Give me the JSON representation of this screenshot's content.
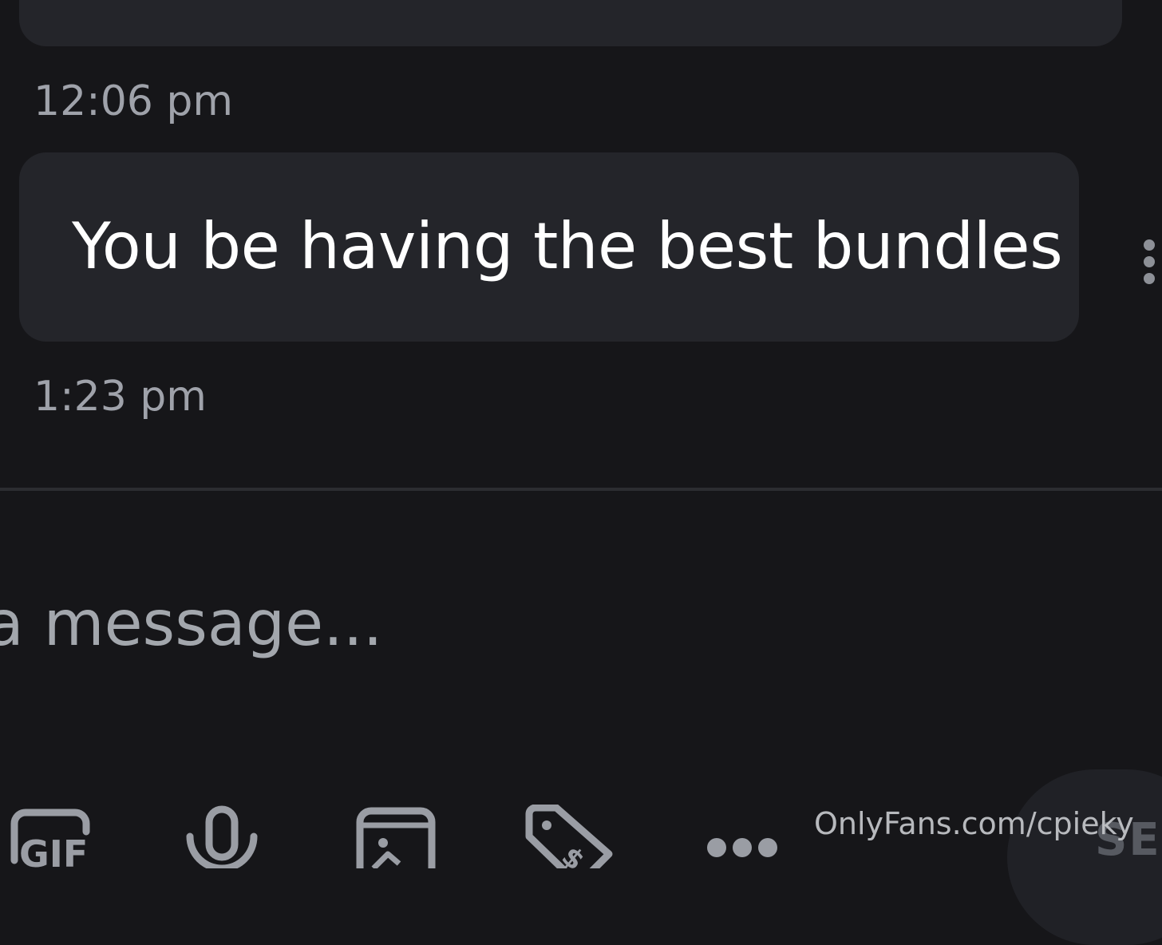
{
  "messages": [
    {
      "text": "",
      "time": "12:06 pm"
    },
    {
      "text": "You be having the best bundles",
      "time": "1:23 pm"
    }
  ],
  "composer": {
    "placeholder": "a message..."
  },
  "toolbar": {
    "icons": [
      "gif-icon",
      "microphone-icon",
      "media-icon",
      "price-tag-icon",
      "more-icon"
    ],
    "send_label": "SE"
  },
  "watermark": "OnlyFans.com/cpieky",
  "colors": {
    "background": "#161619",
    "bubble": "#24252a",
    "muted_text": "#9fa2aa",
    "icon": "#9a9da4"
  }
}
